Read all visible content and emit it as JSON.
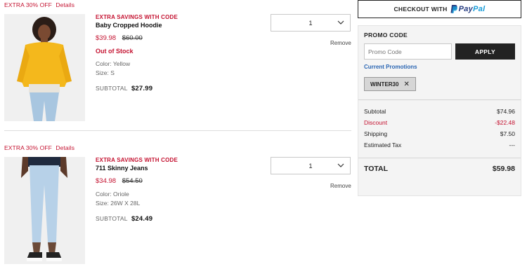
{
  "items": [
    {
      "promo_text": "EXTRA 30% OFF",
      "details_link": "Details",
      "extra_savings": "EXTRA SAVINGS WITH CODE",
      "name": "Baby Cropped Hoodie",
      "sale_price": "$39.98",
      "original_price": "$60.00",
      "stock_status": "Out of Stock",
      "color": "Color: Yellow",
      "size": "Size: S",
      "subtotal_label": "SUBTOTAL",
      "subtotal_value": "$27.99",
      "quantity": "1",
      "remove_label": "Remove"
    },
    {
      "promo_text": "EXTRA 30% OFF",
      "details_link": "Details",
      "extra_savings": "EXTRA SAVINGS WITH CODE",
      "name": "711 Skinny Jeans",
      "sale_price": "$34.98",
      "original_price": "$54.50",
      "color": "Color: Oriole",
      "size": "Size: 26W X 28L",
      "subtotal_label": "SUBTOTAL",
      "subtotal_value": "$24.49",
      "quantity": "1",
      "remove_label": "Remove"
    }
  ],
  "sidebar": {
    "checkout_label": "CHECKOUT WITH",
    "paypal_part1": "Pay",
    "paypal_part2": "Pal",
    "promo_title": "PROMO CODE",
    "promo_placeholder": "Promo Code",
    "apply_label": "APPLY",
    "current_promotions": "Current Promotions",
    "applied_code": "WINTER30",
    "summary": {
      "subtotal_label": "Subtotal",
      "subtotal_value": "$74.96",
      "discount_label": "Discount",
      "discount_value": "-$22.48",
      "shipping_label": "Shipping",
      "shipping_value": "$7.50",
      "tax_label": "Estimated Tax",
      "tax_value": "---",
      "total_label": "TOTAL",
      "total_value": "$59.98"
    }
  },
  "colors": {
    "accent_red": "#c41230",
    "link_blue": "#2b66b3",
    "paypal_dark": "#253b80",
    "paypal_light": "#179bd7"
  }
}
